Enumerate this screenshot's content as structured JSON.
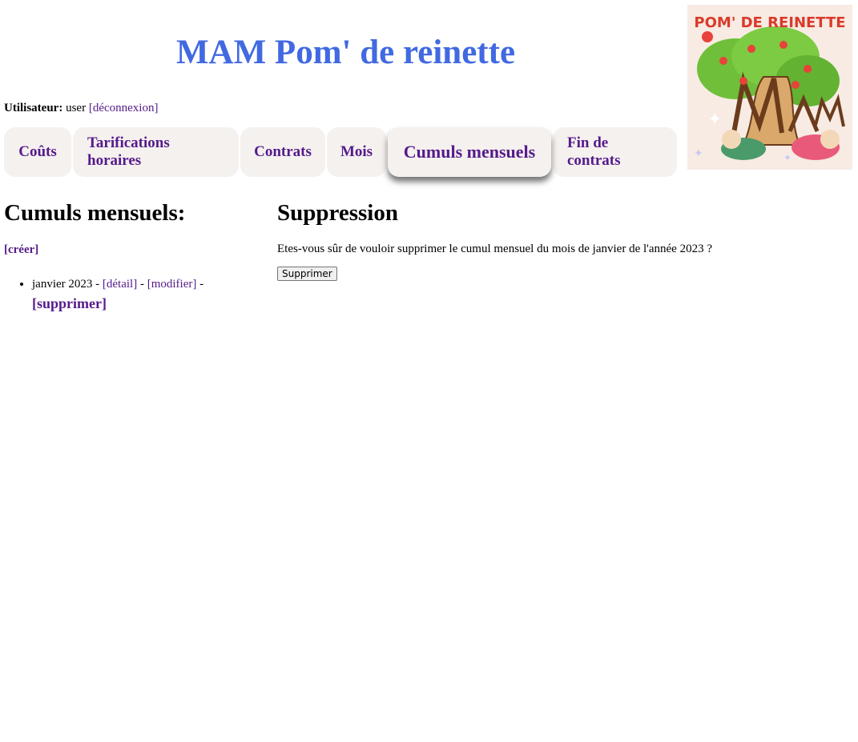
{
  "header": {
    "title": "MAM Pom' de reinette",
    "logo_text": "POM' DE REINETTE",
    "logo_letters": "MAM"
  },
  "user": {
    "label": "Utilisateur:",
    "name": "user",
    "logout": "[déconnexion]"
  },
  "nav": {
    "tabs": [
      {
        "label": "Coûts"
      },
      {
        "label": "Tarifications horaires"
      },
      {
        "label": "Contrats"
      },
      {
        "label": "Mois"
      },
      {
        "label": "Cumuls mensuels"
      },
      {
        "label": "Fin de contrats"
      }
    ],
    "active": "Cumuls mensuels"
  },
  "list": {
    "heading": "Cumuls mensuels:",
    "create": "[créer]",
    "items": [
      {
        "name": "janvier 2023",
        "sep1": " - ",
        "detail": "[détail]",
        "sep2": " - ",
        "edit": "[modifier]",
        "sep3": " - ",
        "delete": "[supprimer]"
      }
    ]
  },
  "deletion": {
    "heading": "Suppression",
    "message": "Etes-vous sûr de vouloir supprimer le cumul mensuel du mois de janvier de l'année 2023 ?",
    "button": "Supprimer"
  },
  "colors": {
    "title": "#4169e1",
    "link": "#551a8b",
    "tab_bg": "#f5f1ef"
  }
}
